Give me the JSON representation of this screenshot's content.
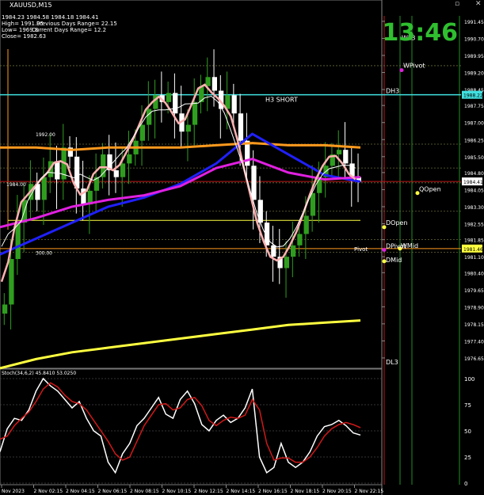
{
  "header": {
    "symbol": "XAUUSD,M15",
    "ohlc": "1984.23 1984.58 1984.18 1984.41",
    "high_line": "High= 1991.95",
    "prev_range": "Previous Days Range= 22.15",
    "low_line": "Low= 1969.8",
    "curr_range": "Current Days Range= 12.2",
    "close_line": "Close= 1982.63"
  },
  "clock": "13:46",
  "window_buttons": [
    "▫",
    "✕"
  ],
  "price_labels": {
    "current": "1984.41",
    "h3": "1988.22",
    "pivot": "1981.46"
  },
  "annotations": {
    "h3_short": "H3 SHORT",
    "dh3": "DH3",
    "wpivot": "WPivot",
    "wl3": "WL3",
    "qopen": "QOpen",
    "dopen": "DOpen",
    "dpivot": "DPivot",
    "wmid": "WMid",
    "dmid": "DMid",
    "pivot": "Pivot",
    "dl3": "DL3",
    "left_level_1": "1992.00",
    "left_level_2": "300.00",
    "left_level_3": "1984.00"
  },
  "stoch_header": "Stoch(34,6,2) 45.8410 53.0250",
  "colors": {
    "bg": "#000000",
    "bull": "#2f9e1f",
    "bear": "#ffffff",
    "orange": "#ff9a1e",
    "blue": "#2020ff",
    "magenta": "#e020e0",
    "pink": "#ffb0b0",
    "yellow": "#ffff40",
    "cyan": "#40e0e0",
    "green_vline": "#1f8f1f",
    "red_line": "#c01818",
    "stoch_main": "#ffffff",
    "stoch_signal": "#d01818"
  },
  "chart_data": [
    {
      "type": "candlestick",
      "title": "XAUUSD,M15",
      "x_ticks": [
        "Nov 2023",
        "2 Nov 02:15",
        "2 Nov 04:15",
        "2 Nov 06:15",
        "2 Nov 08:15",
        "2 Nov 10:15",
        "2 Nov 12:15",
        "2 Nov 14:15",
        "2 Nov 16:15",
        "2 Nov 18:15",
        "2 Nov 20:15",
        "2 Nov 22:15"
      ],
      "y_ticks": [
        1991.45,
        1990.7,
        1989.95,
        1989.2,
        1988.45,
        1987.75,
        1987.0,
        1986.25,
        1985.5,
        1984.8,
        1984.05,
        1983.3,
        1982.55,
        1981.85,
        1981.1,
        1980.4,
        1979.65,
        1978.9,
        1978.15,
        1977.4,
        1976.65
      ],
      "ylim": [
        1976.3,
        1991.9
      ],
      "close_series": [
        1979.0,
        1981.0,
        1982.6,
        1983.6,
        1984.3,
        1983.6,
        1984.6,
        1985.3,
        1984.5,
        1985.9,
        1985.5,
        1984.1,
        1983.4,
        1984.0,
        1984.6,
        1985.6,
        1984.9,
        1984.6,
        1985.2,
        1985.6,
        1986.2,
        1986.9,
        1987.6,
        1988.2,
        1987.9,
        1988.3,
        1987.4,
        1986.6,
        1986.9,
        1987.9,
        1988.6,
        1989.0,
        1988.4,
        1987.6,
        1988.2,
        1987.4,
        1986.2,
        1985.1,
        1983.6,
        1982.6,
        1981.6,
        1981.1,
        1980.6,
        1981.1,
        1981.6,
        1982.1,
        1982.9,
        1983.9,
        1984.6,
        1985.1,
        1985.6,
        1985.8,
        1985.2,
        1984.6,
        1984.4
      ],
      "moving_averages": [
        {
          "color": "orange",
          "values": [
            1985.9,
            1985.9,
            1985.8,
            1985.9,
            1985.9,
            1985.9,
            1986.0,
            1986.1,
            1986.0,
            1986.0,
            1985.9
          ]
        },
        {
          "color": "blue",
          "values": [
            1981.2,
            1981.9,
            1982.6,
            1983.3,
            1983.7,
            1984.3,
            1985.2,
            1986.5,
            1985.6,
            1984.7,
            1984.4
          ]
        },
        {
          "color": "magenta",
          "values": [
            1982.4,
            1982.8,
            1983.3,
            1983.6,
            1983.8,
            1984.2,
            1985.0,
            1985.4,
            1984.8,
            1984.5,
            1984.6
          ]
        },
        {
          "color": "yellow",
          "values": [
            1976.2,
            1976.6,
            1976.9,
            1977.1,
            1977.3,
            1977.5,
            1977.7,
            1977.9,
            1978.1,
            1978.2,
            1978.3
          ]
        }
      ],
      "levels": [
        {
          "name": "DH3",
          "value": 1988.22,
          "color": "cyan"
        },
        {
          "name": "Current",
          "value": 1984.41,
          "color": "red_line"
        },
        {
          "name": "DOpen",
          "value": 1982.7,
          "color": "yellow"
        },
        {
          "name": "Pivot",
          "value": 1981.46,
          "color": "orange"
        }
      ]
    },
    {
      "type": "line",
      "title": "Stoch(34,6,2) 45.8410 53.0250",
      "y_ticks": [
        100,
        75,
        50,
        25,
        0
      ],
      "ylim": [
        0,
        100
      ],
      "series": [
        {
          "color": "stoch_main",
          "values": [
            30,
            52,
            62,
            60,
            70,
            88,
            100,
            93,
            88,
            80,
            72,
            78,
            62,
            50,
            45,
            20,
            10,
            28,
            38,
            55,
            62,
            72,
            82,
            66,
            62,
            80,
            88,
            76,
            56,
            50,
            60,
            65,
            58,
            62,
            72,
            90,
            25,
            10,
            15,
            38,
            20,
            15,
            20,
            30,
            45,
            54,
            56,
            60,
            55,
            48,
            46
          ]
        },
        {
          "color": "stoch_signal",
          "values": [
            42,
            45,
            55,
            62,
            68,
            78,
            90,
            96,
            92,
            84,
            78,
            76,
            70,
            60,
            50,
            40,
            28,
            22,
            25,
            40,
            55,
            65,
            75,
            76,
            70,
            72,
            80,
            82,
            74,
            60,
            55,
            60,
            63,
            62,
            65,
            80,
            70,
            38,
            22,
            24,
            24,
            20,
            20,
            25,
            34,
            45,
            52,
            56,
            58,
            56,
            53
          ]
        }
      ]
    }
  ]
}
